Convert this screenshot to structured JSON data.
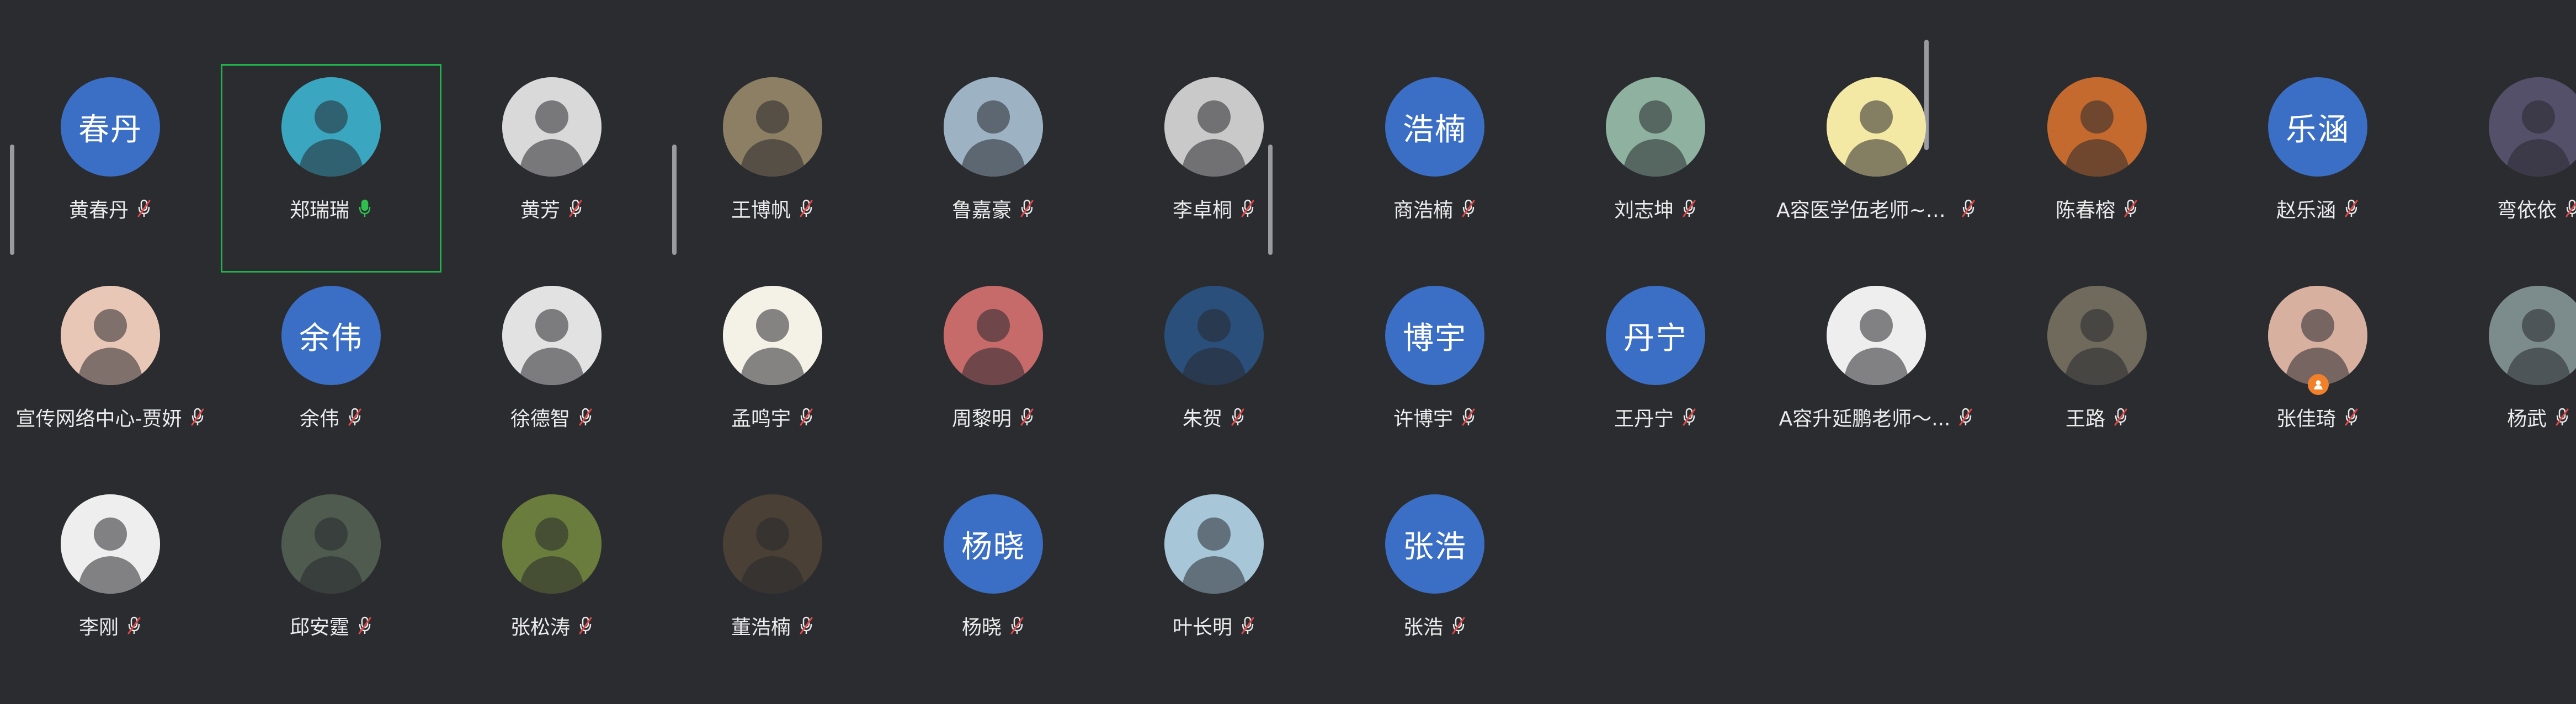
{
  "participants": [
    {
      "name": "黄春丹",
      "initials": "春丹",
      "mic": "muted",
      "bg": "#3b6fc6"
    },
    {
      "name": "郑瑞瑞",
      "mic": "active",
      "speaking": true,
      "bg": "#3aa6c0",
      "avatar_icon": "girl-with-glasses-avatar-icon"
    },
    {
      "name": "黄芳",
      "mic": "muted",
      "bg": "#d9d9d9",
      "avatar_icon": "woman-in-suit-photo-icon"
    },
    {
      "name": "王博帆",
      "mic": "muted",
      "bg": "#8c7f64",
      "avatar_icon": "man-with-guitar-photo-icon"
    },
    {
      "name": "鲁嘉豪",
      "mic": "muted",
      "bg": "#9db3c4",
      "avatar_icon": "shark-hat-photo-icon"
    },
    {
      "name": "李卓桐",
      "mic": "muted",
      "bg": "#c9c9c9",
      "avatar_icon": "man-in-tuxedo-photo-icon"
    },
    {
      "name": "商浩楠",
      "initials": "浩楠",
      "mic": "muted",
      "bg": "#3b6fc6"
    },
    {
      "name": "刘志坤",
      "mic": "muted",
      "bg": "#8fb2a0",
      "avatar_icon": "mountain-landscape-photo-icon"
    },
    {
      "name": "A容医学伍老师~1...",
      "mic": "muted",
      "bg": "#f4e9a4",
      "avatar_icon": "school-poster-photo-icon"
    },
    {
      "name": "陈春榕",
      "mic": "muted",
      "bg": "#c56a2f",
      "avatar_icon": "person-in-black-photo-icon"
    },
    {
      "name": "赵乐涵",
      "initials": "乐涵",
      "mic": "muted",
      "bg": "#3b6fc6"
    },
    {
      "name": "弯依依",
      "mic": "muted",
      "bg": "#54506a",
      "avatar_icon": "girl-with-microphone-photo-icon"
    },
    {
      "name": "宣传网络中心-贾妍",
      "mic": "muted",
      "bg": "#e9c7b7",
      "avatar_icon": "smiling-woman-photo-icon"
    },
    {
      "name": "余伟",
      "initials": "余伟",
      "mic": "muted",
      "bg": "#3b6fc6"
    },
    {
      "name": "徐德智",
      "mic": "muted",
      "bg": "#e2e2e2",
      "avatar_icon": "young-man-photo-icon"
    },
    {
      "name": "孟鸣宇",
      "mic": "muted",
      "bg": "#f4f1e6",
      "avatar_icon": "illustrated-girl-icon"
    },
    {
      "name": "周黎明",
      "mic": "muted",
      "bg": "#c66a6a",
      "avatar_icon": "cartoon-group-photo-icon"
    },
    {
      "name": "朱贺",
      "mic": "muted",
      "bg": "#2a4f7a",
      "avatar_icon": "cartoon-character-photo-icon"
    },
    {
      "name": "许博宇",
      "initials": "博宇",
      "mic": "muted",
      "bg": "#3b6fc6"
    },
    {
      "name": "王丹宁",
      "initials": "丹宁",
      "mic": "muted",
      "bg": "#3b6fc6"
    },
    {
      "name": "A容升延鹏老师～...",
      "mic": "muted",
      "bg": "#eeeeee",
      "avatar_icon": "man-with-hearts-photo-icon"
    },
    {
      "name": "王路",
      "mic": "muted",
      "bg": "#6f6a5c",
      "avatar_icon": "cat-with-party-hat-photo-icon"
    },
    {
      "name": "张佳琦",
      "mic": "muted",
      "bg": "#d7b0a0",
      "avatar_icon": "woman-selfie-photo-icon",
      "badge": "host-icon"
    },
    {
      "name": "杨武",
      "mic": "muted",
      "bg": "#7c8c8c",
      "avatar_icon": "illustrated-man-icon"
    },
    {
      "name": "李刚",
      "mic": "muted",
      "bg": "#eeeeee",
      "avatar_icon": "man-in-suit-photo-icon"
    },
    {
      "name": "邱安霆",
      "mic": "muted",
      "bg": "#4f5b4f",
      "avatar_icon": "man-in-hallway-photo-icon"
    },
    {
      "name": "张松涛",
      "mic": "muted",
      "bg": "#6a7d3d",
      "avatar_icon": "bride-in-forest-photo-icon"
    },
    {
      "name": "董浩楠",
      "mic": "muted",
      "bg": "#4a4036",
      "avatar_icon": "puppies-photo-icon"
    },
    {
      "name": "杨晓",
      "initials": "杨晓",
      "mic": "muted",
      "bg": "#3b6fc6"
    },
    {
      "name": "叶长明",
      "mic": "muted",
      "bg": "#a7c7d8",
      "avatar_icon": "man-at-beach-photo-icon"
    },
    {
      "name": "张浩",
      "initials": "张浩",
      "mic": "muted",
      "bg": "#3b6fc6"
    }
  ],
  "colors": {
    "background": "#2b2c30",
    "initials_bg": "#3b6fc6",
    "speaking_border": "#22b14c",
    "muted_slash": "#e04646",
    "active_mic": "#2fbf4f"
  }
}
